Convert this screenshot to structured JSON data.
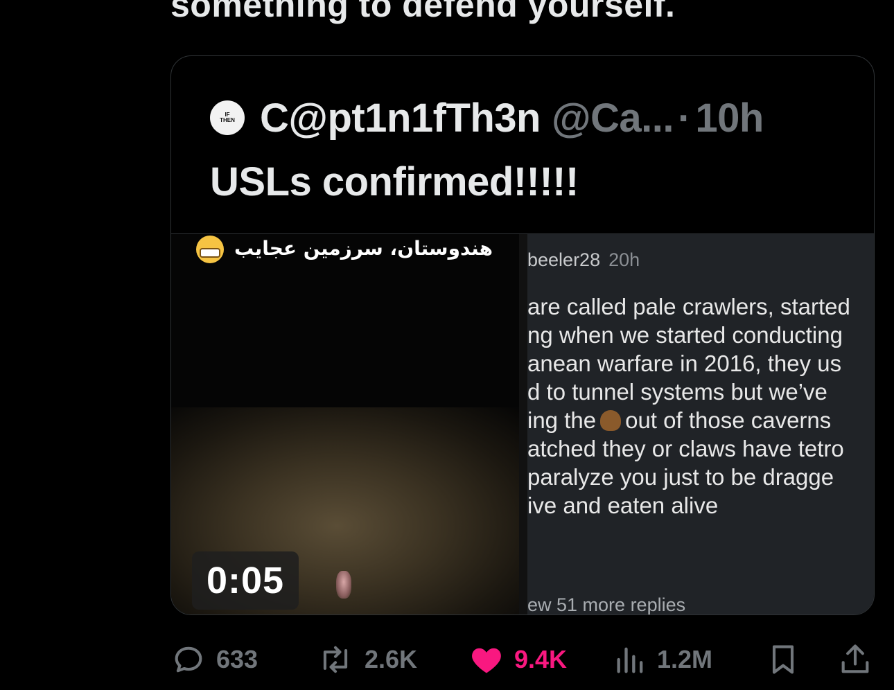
{
  "tweet": {
    "text_partial": "something to defend yourself."
  },
  "quote": {
    "avatar_text_top": "IF",
    "avatar_text_bottom": "THEN",
    "display_name": "C@pt1n1fTh3n",
    "handle": "@Ca...",
    "separator": "·",
    "time": "10h",
    "body": "USLs confirmed!!!!!",
    "video": {
      "caption": "هندوستان، سرزمین عجایب",
      "duration": "0:05"
    },
    "screenshot": {
      "username": "beeler28",
      "time": "20h",
      "lines": [
        "are called pale crawlers, started",
        "ng when we started conducting",
        "anean warfare in 2016, they us",
        "d to tunnel systems but we’ve",
        "ing the",
        "out of those caverns",
        "atched they or claws have tetro",
        "paralyze you just to be dragge",
        "ive and eaten alive"
      ],
      "more_replies": "ew 51 more replies"
    }
  },
  "actions": {
    "replies": "633",
    "reposts": "2.6K",
    "likes": "9.4K",
    "views": "1.2M"
  },
  "colors": {
    "like_active": "#f91880",
    "muted": "#71767b",
    "text": "#e7e9ea"
  }
}
